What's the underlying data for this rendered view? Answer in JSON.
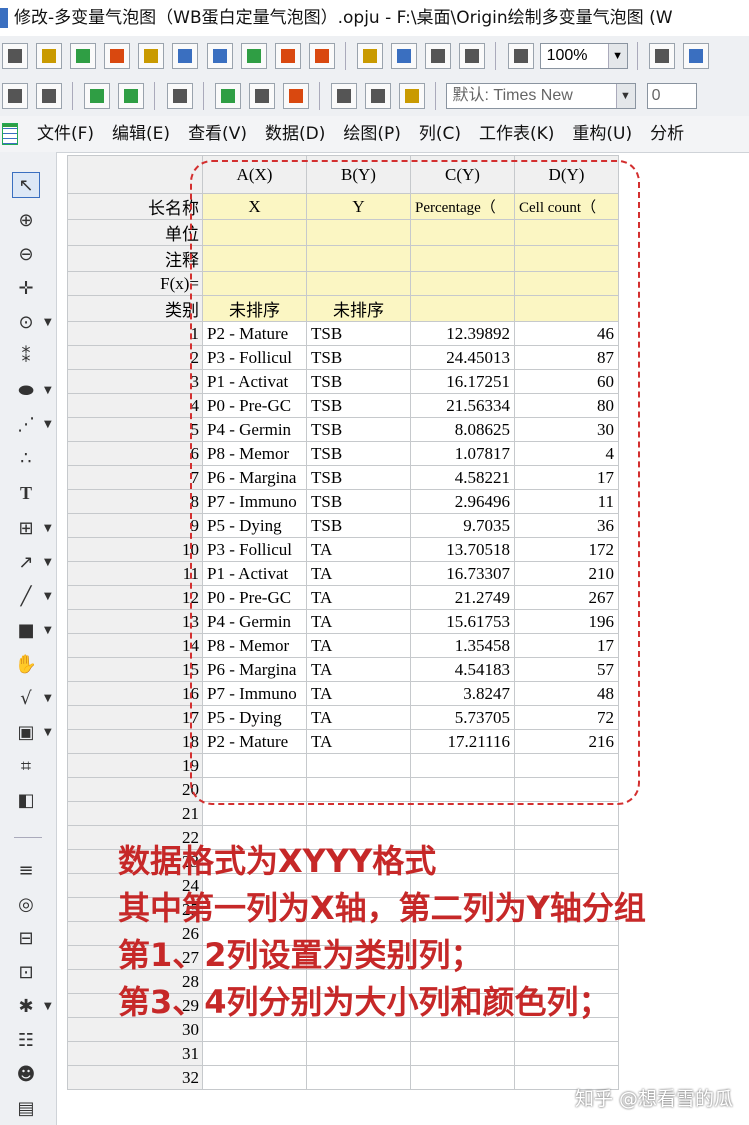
{
  "window": {
    "title": "修改-多变量气泡图（WB蛋白定量气泡图）.opju - F:\\桌面\\Origin绘制多变量气泡图 (W"
  },
  "toolbar": {
    "zoom_value": "100%",
    "font_value": "默认: Times New",
    "font_size_value": "0"
  },
  "menu": {
    "items": [
      "文件(F)",
      "编辑(E)",
      "查看(V)",
      "数据(D)",
      "绘图(P)",
      "列(C)",
      "工作表(K)",
      "重构(U)",
      "分析"
    ]
  },
  "left_tools": [
    "pointer-icon",
    "zoom-in-icon",
    "zoom-out-icon",
    "crosshair-icon",
    "data-reader-icon",
    "screen-reader-icon",
    "mask-icon",
    "draw-data-icon",
    "scatter-icon",
    "text-icon",
    "grid-icon",
    "arrow-icon",
    "line-icon",
    "rectangle-icon",
    "hand-icon",
    "equation-icon",
    "graph-icon",
    "region-icon",
    "cube-icon",
    "lines-icon",
    "circle-icon",
    "stack-icon",
    "bracket-icon",
    "star-icon",
    "list-icon",
    "person-icon",
    "folder-icon"
  ],
  "worksheet": {
    "columns": [
      "A(X)",
      "B(Y)",
      "C(Y)",
      "D(Y)"
    ],
    "meta_rows": [
      {
        "label": "长名称",
        "cells": [
          "X",
          "Y",
          "Percentage（",
          "Cell count（"
        ]
      },
      {
        "label": "单位",
        "cells": [
          "",
          "",
          "",
          ""
        ]
      },
      {
        "label": "注释",
        "cells": [
          "",
          "",
          "",
          ""
        ]
      },
      {
        "label": "F(x)=",
        "cells": [
          "",
          "",
          "",
          ""
        ]
      },
      {
        "label": "类别",
        "cells": [
          "未排序",
          "未排序",
          "",
          ""
        ]
      }
    ],
    "rows": [
      {
        "n": "1",
        "a": "P2 - Mature",
        "b": "TSB",
        "c": "12.39892",
        "d": "46"
      },
      {
        "n": "2",
        "a": "P3 - Follicul",
        "b": "TSB",
        "c": "24.45013",
        "d": "87"
      },
      {
        "n": "3",
        "a": "P1 - Activat",
        "b": "TSB",
        "c": "16.17251",
        "d": "60"
      },
      {
        "n": "4",
        "a": "P0 - Pre-GC",
        "b": "TSB",
        "c": "21.56334",
        "d": "80"
      },
      {
        "n": "5",
        "a": "P4 - Germin",
        "b": "TSB",
        "c": "8.08625",
        "d": "30"
      },
      {
        "n": "6",
        "a": "P8 - Memor",
        "b": "TSB",
        "c": "1.07817",
        "d": "4"
      },
      {
        "n": "7",
        "a": "P6 - Margina",
        "b": "TSB",
        "c": "4.58221",
        "d": "17"
      },
      {
        "n": "8",
        "a": "P7 - Immuno",
        "b": "TSB",
        "c": "2.96496",
        "d": "11"
      },
      {
        "n": "9",
        "a": "P5 - Dying",
        "b": "TSB",
        "c": "9.7035",
        "d": "36"
      },
      {
        "n": "10",
        "a": "P3 - Follicul",
        "b": "TA",
        "c": "13.70518",
        "d": "172"
      },
      {
        "n": "11",
        "a": "P1 - Activat",
        "b": "TA",
        "c": "16.73307",
        "d": "210"
      },
      {
        "n": "12",
        "a": "P0 - Pre-GC",
        "b": "TA",
        "c": "21.2749",
        "d": "267"
      },
      {
        "n": "13",
        "a": "P4 - Germin",
        "b": "TA",
        "c": "15.61753",
        "d": "196"
      },
      {
        "n": "14",
        "a": "P8 - Memor",
        "b": "TA",
        "c": "1.35458",
        "d": "17"
      },
      {
        "n": "15",
        "a": "P6 - Margina",
        "b": "TA",
        "c": "4.54183",
        "d": "57"
      },
      {
        "n": "16",
        "a": "P7 - Immuno",
        "b": "TA",
        "c": "3.8247",
        "d": "48"
      },
      {
        "n": "17",
        "a": "P5 - Dying",
        "b": "TA",
        "c": "5.73705",
        "d": "72"
      },
      {
        "n": "18",
        "a": "P2 - Mature",
        "b": "TA",
        "c": "17.21116",
        "d": "216"
      },
      {
        "n": "19",
        "a": "",
        "b": "",
        "c": "",
        "d": ""
      },
      {
        "n": "20",
        "a": "",
        "b": "",
        "c": "",
        "d": ""
      },
      {
        "n": "21",
        "a": "",
        "b": "",
        "c": "",
        "d": ""
      },
      {
        "n": "22",
        "a": "",
        "b": "",
        "c": "",
        "d": ""
      },
      {
        "n": "23",
        "a": "",
        "b": "",
        "c": "",
        "d": ""
      },
      {
        "n": "24",
        "a": "",
        "b": "",
        "c": "",
        "d": ""
      },
      {
        "n": "25",
        "a": "",
        "b": "",
        "c": "",
        "d": ""
      },
      {
        "n": "26",
        "a": "",
        "b": "",
        "c": "",
        "d": ""
      },
      {
        "n": "27",
        "a": "",
        "b": "",
        "c": "",
        "d": ""
      },
      {
        "n": "28",
        "a": "",
        "b": "",
        "c": "",
        "d": ""
      },
      {
        "n": "29",
        "a": "",
        "b": "",
        "c": "",
        "d": ""
      },
      {
        "n": "30",
        "a": "",
        "b": "",
        "c": "",
        "d": ""
      },
      {
        "n": "31",
        "a": "",
        "b": "",
        "c": "",
        "d": ""
      },
      {
        "n": "32",
        "a": "",
        "b": "",
        "c": "",
        "d": ""
      }
    ]
  },
  "annotation": {
    "lines": [
      "数据格式为XYYY格式",
      "其中第一列为X轴，第二列为Y轴分组",
      "第1、2列设置为类别列；",
      "第3、4列分别为大小列和颜色列；"
    ],
    "color": "#c62828"
  },
  "watermark": "知乎 @想看雪的瓜"
}
